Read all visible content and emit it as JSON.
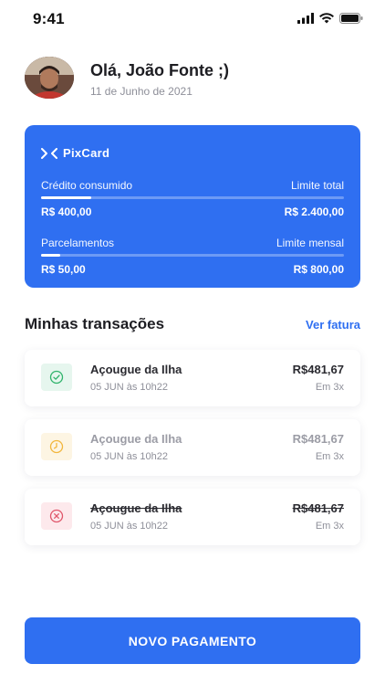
{
  "status_bar": {
    "time": "9:41"
  },
  "user": {
    "greeting": "Olá, João Fonte ;)",
    "date": "11 de Junho de 2021"
  },
  "card": {
    "brand": "PixCard",
    "credit": {
      "left_label": "Crédito consumido",
      "right_label": "Limite total",
      "left_value": "R$ 400,00",
      "right_value": "R$ 2.400,00",
      "progress": 0.167
    },
    "installments": {
      "left_label": "Parcelamentos",
      "right_label": "Limite mensal",
      "left_value": "R$ 50,00",
      "right_value": "R$ 800,00",
      "progress": 0.0625
    }
  },
  "transactions_section": {
    "title": "Minhas transações",
    "link": "Ver fatura"
  },
  "transactions": [
    {
      "name": "Açougue da Ilha",
      "date": "05 JUN às 10h22",
      "amount": "R$481,67",
      "installments": "Em 3x",
      "status": "approved",
      "icon": "check-circle-icon"
    },
    {
      "name": "Açougue da Ilha",
      "date": "05 JUN às 10h22",
      "amount": "R$481,67",
      "installments": "Em 3x",
      "status": "pending",
      "icon": "clock-icon"
    },
    {
      "name": "Açougue da Ilha",
      "date": "05 JUN às 10h22",
      "amount": "R$481,67",
      "installments": "Em 3x",
      "status": "cancelled",
      "icon": "x-circle-icon"
    }
  ],
  "cta": {
    "label": "NOVO PAGAMENTO"
  },
  "colors": {
    "accent": "#2f6ff1",
    "approved": "#2fb36b",
    "pending": "#f2b63c",
    "cancelled": "#e0566a"
  }
}
